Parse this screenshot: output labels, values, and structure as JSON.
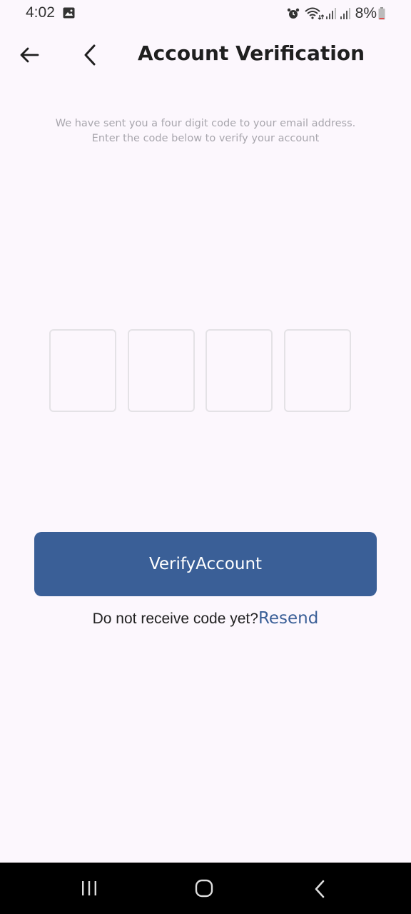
{
  "status_bar": {
    "time": "4:02",
    "battery": "8%"
  },
  "app_bar": {
    "title": "Account Verification"
  },
  "instructions": {
    "line1": "We have sent you a four digit code to your email address.",
    "line2": "Enter the code below to verify your account"
  },
  "code_inputs": [
    "",
    "",
    "",
    ""
  ],
  "verify_button": {
    "label": "VerifyAccount"
  },
  "resend": {
    "prompt": "Do not receive code yet?",
    "link": "Resend"
  },
  "colors": {
    "background": "#fcf7fd",
    "primary": "#3a5f97",
    "box_border": "#e4e2e6",
    "hint_text": "#a8a6ad"
  }
}
